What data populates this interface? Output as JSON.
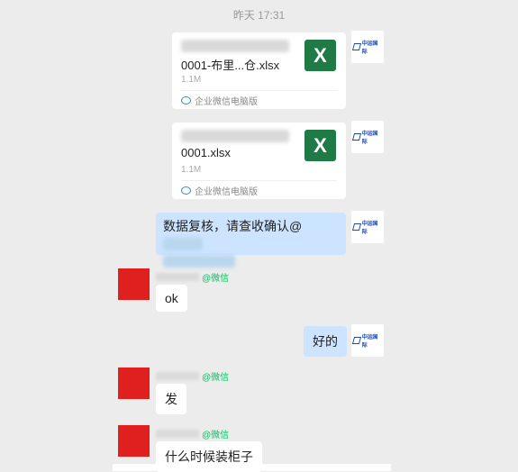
{
  "timestamp": "昨天  17:31",
  "org_avatar": {
    "logo_text": "中运国际"
  },
  "files": [
    {
      "name": "0001-布里...仓.xlsx",
      "size": "1.1M",
      "source": "企业微信电脑版",
      "icon": "excel-icon",
      "icon_letter": "X"
    },
    {
      "name": "0001.xlsx",
      "size": "1.1M",
      "source": "企业微信电脑版",
      "icon": "excel-icon",
      "icon_letter": "X"
    }
  ],
  "messages": {
    "review": "数据复核，请查收确认@",
    "ok": "ok",
    "haode": "好的",
    "fa": "发",
    "question": "什么时候装柜子"
  },
  "sender_tag": "@微信",
  "colors": {
    "excel": "#1f7a45",
    "wechat_green": "#07c160",
    "avatar_red": "#e0201e",
    "bubble_blue": "#cce4ff"
  }
}
